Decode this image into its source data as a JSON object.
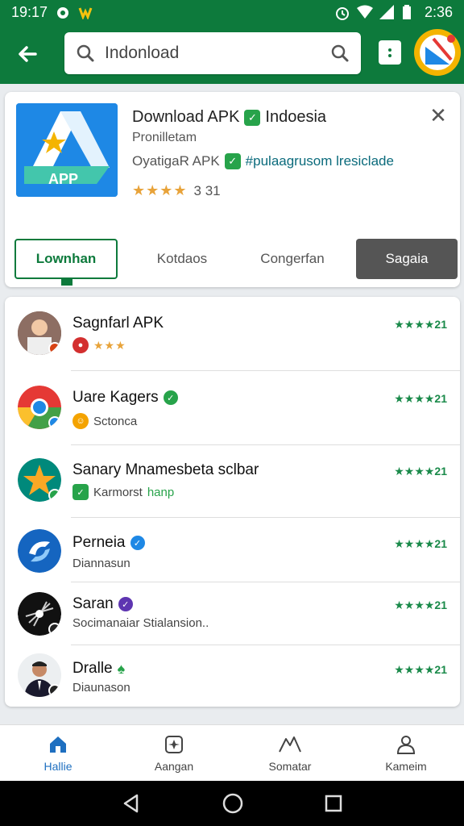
{
  "status_bar": {
    "time_left": "19:17",
    "time_right": "2:36"
  },
  "search": {
    "query": "Indonload"
  },
  "app": {
    "title": "Download APK",
    "title_suffix": "Indoesia",
    "subtitle": "Pronilletam",
    "developer": "OyatigaR APK",
    "tag": "#pulaagrusom lresiclade",
    "rating": "3 31",
    "stars": "★★★★",
    "icon_label": "APP"
  },
  "tabs": [
    {
      "label": "Lownhan",
      "state": "active"
    },
    {
      "label": "Kotdaos",
      "state": "normal"
    },
    {
      "label": "Congerfan",
      "state": "normal"
    },
    {
      "label": "Sagaia",
      "state": "dark"
    }
  ],
  "list": [
    {
      "name": "Sagnfarl APK",
      "sub": "★★★",
      "rating": "★★★★21"
    },
    {
      "name": "Uare Kagers",
      "sub": "Sctonca",
      "rating": "★★★★21"
    },
    {
      "name": "Sanary Mnamesbeta sclbar",
      "sub": "Karmorst",
      "sub_green": "hanp",
      "rating": "★★★★21"
    },
    {
      "name": "Perneia",
      "sub": "Diannasun",
      "rating": "★★★★21"
    },
    {
      "name": "Saran",
      "sub": "Socimanaiar Stialansion..",
      "rating": "★★★★21"
    },
    {
      "name": "Dralle",
      "sub": "Diaunason",
      "rating": "★★★★21"
    }
  ],
  "bottom_nav": [
    {
      "label": "Hallie",
      "icon": "home-icon",
      "active": true
    },
    {
      "label": "Aangan",
      "icon": "sparkle-icon",
      "active": false
    },
    {
      "label": "Somatar",
      "icon": "mountain-icon",
      "active": false
    },
    {
      "label": "Kameim",
      "icon": "person-icon",
      "active": false
    }
  ],
  "colors": {
    "primary": "#0d7a3c",
    "accent_blue": "#1e6fc0",
    "star": "#e8a33a",
    "rating_green": "#1a8a4a"
  }
}
